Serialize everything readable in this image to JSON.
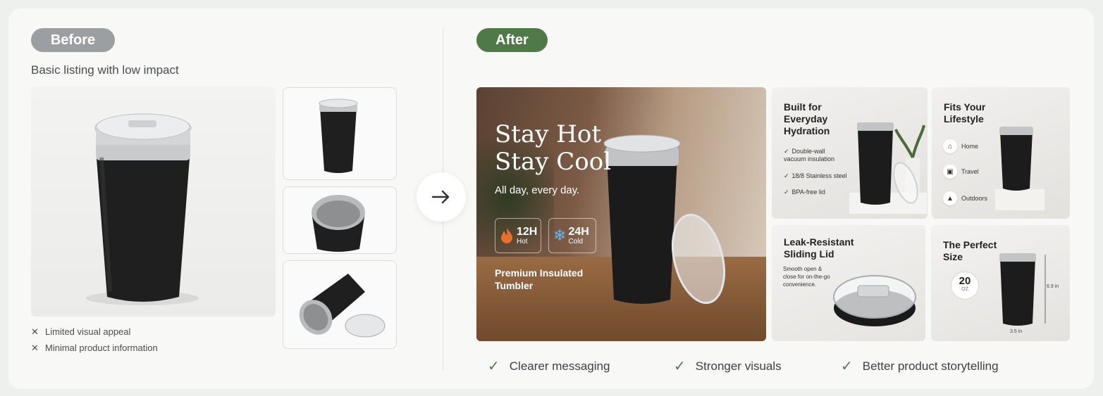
{
  "before": {
    "label": "Before",
    "subtitle": "Basic listing with low impact",
    "cons": [
      "Limited visual appeal",
      "Minimal product information"
    ]
  },
  "after": {
    "label": "After",
    "hero": {
      "title_line1": "Stay Hot",
      "title_line2": "Stay Cool",
      "subtitle": "All day, every day.",
      "hot_value": "12H",
      "hot_label": "Hot",
      "cold_value": "24H",
      "cold_label": "Cold",
      "footer": "Premium Insulated Tumbler"
    },
    "tile_features": {
      "title": "Built for Everyday Hydration",
      "items": [
        "Double-wall vacuum insulation",
        "18/8 Stainless steel",
        "BPA-free lid"
      ]
    },
    "tile_lifestyle": {
      "title": "Fits Your Lifestyle",
      "items": [
        "Home",
        "Travel",
        "Outdoors"
      ]
    },
    "tile_lid": {
      "title": "Leak-Resistant Sliding Lid",
      "description": "Smooth open & close for on-the-go convenience."
    },
    "tile_size": {
      "title": "The Perfect Size",
      "capacity_value": "20",
      "capacity_unit": "OZ",
      "height": "6.9 in",
      "width": "3.5 in"
    },
    "benefits": [
      "Clearer messaging",
      "Stronger visuals",
      "Better product storytelling"
    ]
  },
  "colors": {
    "after_green": "#4f7a47",
    "before_gray": "#9c9fa2",
    "tumbler_black": "#1e1e1e"
  },
  "icons": [
    "x-icon",
    "arrow-right-icon",
    "flame-icon",
    "snowflake-icon",
    "check-icon",
    "home-icon",
    "suitcase-icon",
    "tent-icon"
  ]
}
